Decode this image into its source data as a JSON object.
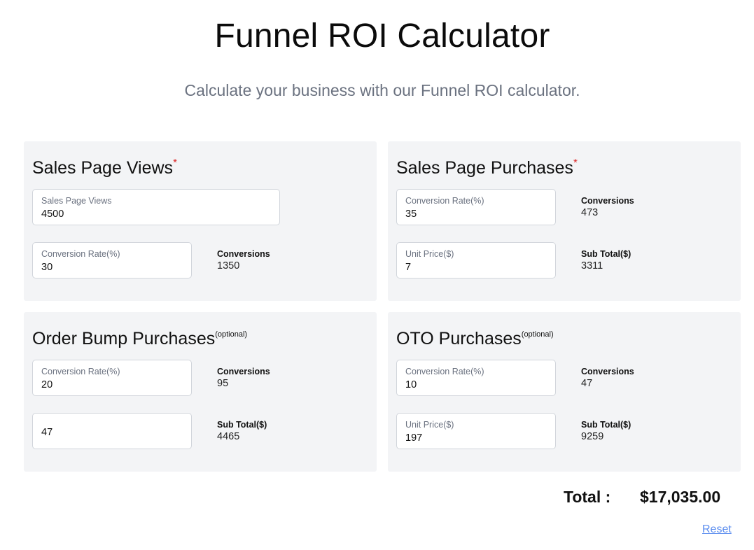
{
  "header": {
    "title": "Funnel ROI Calculator",
    "subtitle": "Calculate your business with our Funnel ROI calculator."
  },
  "sales_page_views": {
    "title": "Sales Page Views",
    "required_mark": "*",
    "views_field": {
      "label": "Sales Page Views",
      "value": "4500"
    },
    "conversion_field": {
      "label": "Conversion Rate(%)",
      "value": "30"
    },
    "conversions": {
      "label": "Conversions",
      "value": "1350"
    }
  },
  "sales_page_purchases": {
    "title": "Sales Page Purchases",
    "required_mark": "*",
    "conversion_field": {
      "label": "Conversion Rate(%)",
      "value": "35"
    },
    "conversions": {
      "label": "Conversions",
      "value": "473"
    },
    "unit_price_field": {
      "label": "Unit Price($)",
      "value": "7"
    },
    "subtotal": {
      "label": "Sub Total($)",
      "value": "3311"
    }
  },
  "order_bump_purchases": {
    "title": "Order Bump Purchases",
    "optional_mark": "(optional)",
    "conversion_field": {
      "label": "Conversion Rate(%)",
      "value": "20"
    },
    "conversions": {
      "label": "Conversions",
      "value": "95"
    },
    "price_field": {
      "value": "47"
    },
    "subtotal": {
      "label": "Sub Total($)",
      "value": "4465"
    }
  },
  "oto_purchases": {
    "title": "OTO Purchases",
    "optional_mark": "(optional)",
    "conversion_field": {
      "label": "Conversion Rate(%)",
      "value": "10"
    },
    "conversions": {
      "label": "Conversions",
      "value": "47"
    },
    "unit_price_field": {
      "label": "Unit Price($)",
      "value": "197"
    },
    "subtotal": {
      "label": "Sub Total($)",
      "value": "9259"
    }
  },
  "summary": {
    "total_label": "Total :",
    "total_value": "$17,035.00",
    "reset_label": "Reset"
  }
}
